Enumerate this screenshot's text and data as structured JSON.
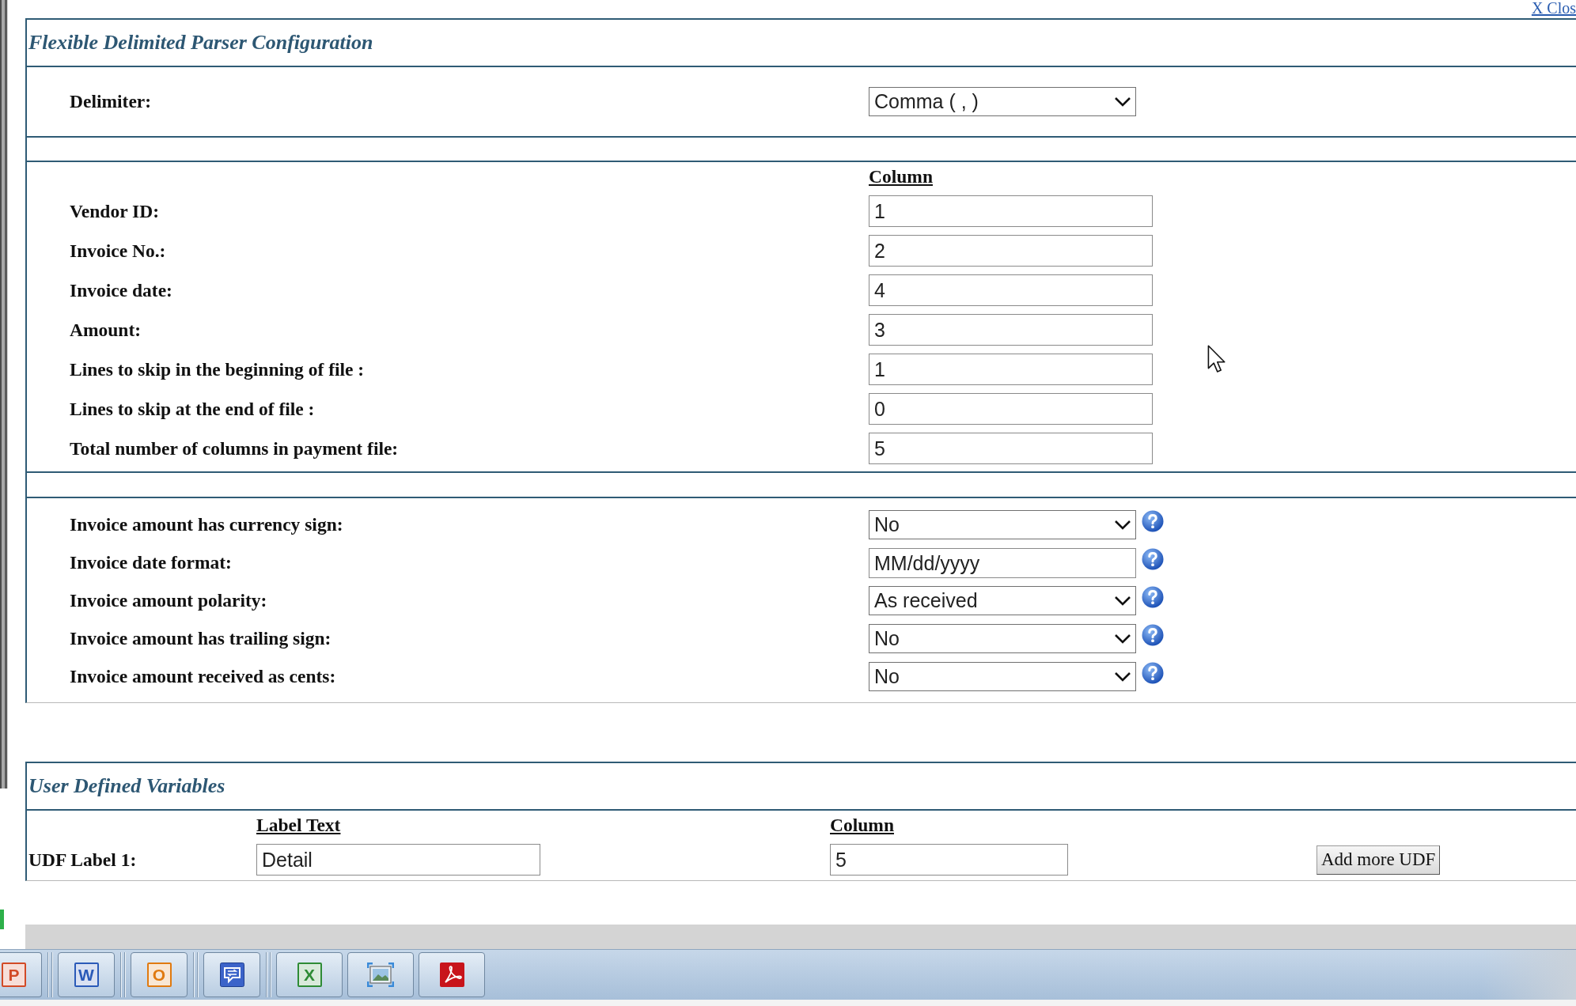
{
  "close_link": "X Clos",
  "parser_config": {
    "title": "Flexible Delimited Parser Configuration",
    "delimiter": {
      "label": "Delimiter:",
      "value": "Comma ( , )"
    },
    "column_header": "Column",
    "column_fields": [
      {
        "label": "Vendor ID:",
        "value": "1"
      },
      {
        "label": "Invoice No.:",
        "value": "2"
      },
      {
        "label": "Invoice date:",
        "value": "4"
      },
      {
        "label": "Amount:",
        "value": "3"
      },
      {
        "label": "Lines to skip in the beginning of file :",
        "value": "1"
      },
      {
        "label": "Lines to skip at the end of file :",
        "value": "0"
      },
      {
        "label": "Total number of columns in payment file:",
        "value": "5"
      }
    ],
    "options": [
      {
        "label": "Invoice amount has currency sign:",
        "kind": "select",
        "value": "No"
      },
      {
        "label": "Invoice date format:",
        "kind": "text",
        "value": "MM/dd/yyyy"
      },
      {
        "label": "Invoice amount polarity:",
        "kind": "select",
        "value": "As received"
      },
      {
        "label": "Invoice amount has trailing sign:",
        "kind": "select",
        "value": "No"
      },
      {
        "label": "Invoice amount received as cents:",
        "kind": "select",
        "value": "No"
      }
    ]
  },
  "user_defined_variables": {
    "title": "User Defined Variables",
    "label_text_header": "Label Text",
    "column_header": "Column",
    "rows": [
      {
        "label": "UDF Label 1:",
        "label_text": "Detail",
        "column": "5"
      }
    ],
    "add_button": "Add more UDF"
  },
  "taskbar": {
    "groups": [
      {
        "buttons": [
          {
            "kind": "letter",
            "glyph": "P",
            "color": "#d24a26"
          }
        ]
      },
      {
        "buttons": [
          {
            "kind": "letter",
            "glyph": "W",
            "color": "#2a5ab8"
          }
        ]
      },
      {
        "buttons": [
          {
            "kind": "letter",
            "glyph": "O",
            "color": "#e07a10"
          }
        ]
      },
      {
        "buttons": [
          {
            "kind": "chat"
          }
        ]
      },
      {
        "buttons": [
          {
            "kind": "letter",
            "glyph": "X",
            "color": "#2e8b35"
          },
          {
            "kind": "picture"
          },
          {
            "kind": "pdf"
          }
        ]
      }
    ]
  }
}
